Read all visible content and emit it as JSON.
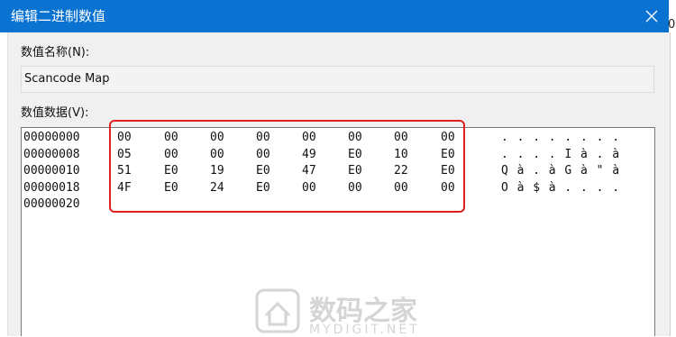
{
  "window": {
    "title": "编辑二进制数值",
    "edge_text": "0"
  },
  "fields": {
    "name_label": "数值名称(N):",
    "name_value": "Scancode Map",
    "data_label": "数值数据(V):"
  },
  "hex_rows": [
    {
      "offset": "00000000",
      "bytes": [
        "00",
        "00",
        "00",
        "00",
        "00",
        "00",
        "00",
        "00"
      ],
      "ascii": "........"
    },
    {
      "offset": "00000008",
      "bytes": [
        "05",
        "00",
        "00",
        "00",
        "49",
        "E0",
        "10",
        "E0"
      ],
      "ascii": "....Ià.à"
    },
    {
      "offset": "00000010",
      "bytes": [
        "51",
        "E0",
        "19",
        "E0",
        "47",
        "E0",
        "22",
        "E0"
      ],
      "ascii": "Qà.àGà\"à"
    },
    {
      "offset": "00000018",
      "bytes": [
        "4F",
        "E0",
        "24",
        "E0",
        "00",
        "00",
        "00",
        "00"
      ],
      "ascii": "Oà$à...."
    },
    {
      "offset": "00000020",
      "bytes": [],
      "ascii": ""
    }
  ],
  "watermark": {
    "cn": "数码之家",
    "en": "MYDIGIT.NET"
  },
  "icons": {
    "close": "close-icon",
    "watermark_logo": "house-logo-icon"
  },
  "colors": {
    "titlebar": "#0a73d1",
    "highlight": "#e02020"
  }
}
